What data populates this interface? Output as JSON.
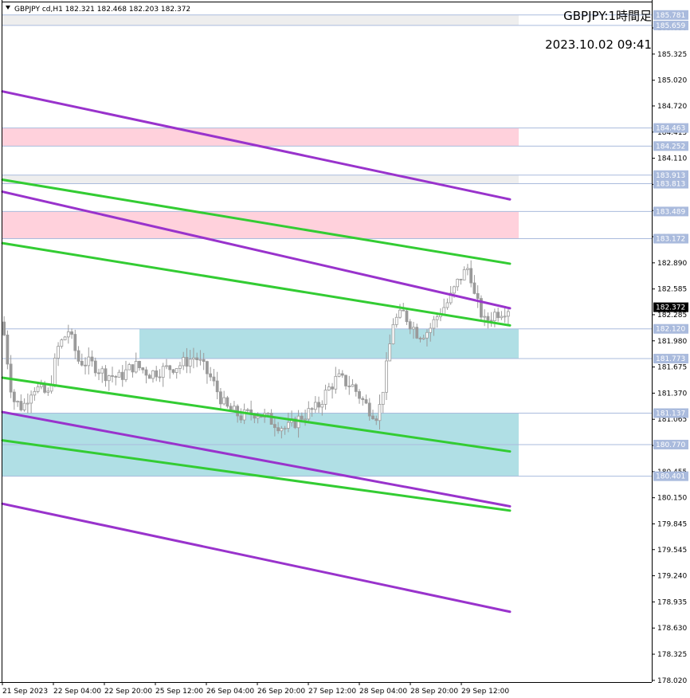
{
  "header": {
    "symbol_line": "GBPJPY cd,H1  182.321 182.468 182.203 182.372",
    "title": "GBPJPY:1時間足",
    "datetime": "2023.10.02 09:41"
  },
  "chart_data": {
    "type": "candlestick",
    "ylim": [
      178.0,
      185.9
    ],
    "price_ticks": [
      "185.630",
      "185.325",
      "185.020",
      "184.720",
      "184.415",
      "184.110",
      "183.805",
      "183.500",
      "183.195",
      "182.890",
      "182.585",
      "182.285",
      "181.980",
      "181.675",
      "181.370",
      "181.065",
      "180.760",
      "180.455",
      "180.150",
      "179.845",
      "179.545",
      "179.240",
      "178.935",
      "178.630",
      "178.325",
      "178.020"
    ],
    "time_labels": [
      "21 Sep 2023",
      "22 Sep 04:00",
      "22 Sep 20:00",
      "25 Sep 12:00",
      "26 Sep 04:00",
      "26 Sep 20:00",
      "27 Sep 12:00",
      "28 Sep 04:00",
      "28 Sep 20:00",
      "29 Sep 12:00"
    ],
    "current_price": "182.372",
    "levels": [
      {
        "label": "185.781",
        "price": 185.781,
        "color": "#aabbdd"
      },
      {
        "label": "185.659",
        "price": 185.659,
        "color": "#aabbdd"
      },
      {
        "label": "184.463",
        "price": 184.463,
        "color": "#aabbdd"
      },
      {
        "label": "184.252",
        "price": 184.252,
        "color": "#aabbdd"
      },
      {
        "label": "183.913",
        "price": 183.913,
        "color": "#aabbdd"
      },
      {
        "label": "183.813",
        "price": 183.813,
        "color": "#aabbdd"
      },
      {
        "label": "183.489",
        "price": 183.489,
        "color": "#aabbdd"
      },
      {
        "label": "183.172",
        "price": 183.172,
        "color": "#aabbdd"
      },
      {
        "label": "182.120",
        "price": 182.12,
        "color": "#aabbdd"
      },
      {
        "label": "181.773",
        "price": 181.773,
        "color": "#aabbdd"
      },
      {
        "label": "181.137",
        "price": 181.137,
        "color": "#aabbdd"
      },
      {
        "label": "180.770",
        "price": 180.77,
        "color": "#aabbdd"
      },
      {
        "label": "180.401",
        "price": 180.401,
        "color": "#aabbdd"
      }
    ],
    "zones": [
      {
        "top": 185.781,
        "bottom": 185.659,
        "color": "#eeeeee"
      },
      {
        "top": 184.463,
        "bottom": 184.252,
        "color": "#ffd1dc"
      },
      {
        "top": 183.913,
        "bottom": 183.813,
        "color": "#eeeeee"
      },
      {
        "top": 183.489,
        "bottom": 183.172,
        "color": "#ffd1dc"
      },
      {
        "top": 182.12,
        "bottom": 181.773,
        "color": "#b0dfe5",
        "start": 0.27
      },
      {
        "top": 181.137,
        "bottom": 180.401,
        "color": "#b0dfe5"
      }
    ],
    "trendlines": [
      {
        "color": "#9933cc",
        "from": [
          0.0,
          184.89
        ],
        "to": [
          1.0,
          183.63
        ]
      },
      {
        "color": "#9933cc",
        "from": [
          0.0,
          183.72
        ],
        "to": [
          1.0,
          182.36
        ]
      },
      {
        "color": "#9933cc",
        "from": [
          0.0,
          181.15
        ],
        "to": [
          1.0,
          180.05
        ]
      },
      {
        "color": "#9933cc",
        "from": [
          0.0,
          180.08
        ],
        "to": [
          1.0,
          178.82
        ]
      },
      {
        "color": "#33cc33",
        "from": [
          0.0,
          183.86
        ],
        "to": [
          1.0,
          182.88
        ]
      },
      {
        "color": "#33cc33",
        "from": [
          0.0,
          183.12
        ],
        "to": [
          1.0,
          182.16
        ]
      },
      {
        "color": "#33cc33",
        "from": [
          0.0,
          181.55
        ],
        "to": [
          1.0,
          180.69
        ]
      },
      {
        "color": "#33cc33",
        "from": [
          0.0,
          180.82
        ],
        "to": [
          1.0,
          180.0
        ]
      }
    ],
    "close_path": [
      [
        0.0,
        182.2
      ],
      [
        0.02,
        181.3
      ],
      [
        0.04,
        181.2
      ],
      [
        0.06,
        181.45
      ],
      [
        0.09,
        181.35
      ],
      [
        0.11,
        181.9
      ],
      [
        0.13,
        182.1
      ],
      [
        0.15,
        181.75
      ],
      [
        0.18,
        181.7
      ],
      [
        0.2,
        181.6
      ],
      [
        0.23,
        181.55
      ],
      [
        0.26,
        181.7
      ],
      [
        0.29,
        181.6
      ],
      [
        0.32,
        181.65
      ],
      [
        0.35,
        181.7
      ],
      [
        0.38,
        181.8
      ],
      [
        0.41,
        181.55
      ],
      [
        0.44,
        181.2
      ],
      [
        0.47,
        181.1
      ],
      [
        0.5,
        181.15
      ],
      [
        0.53,
        181.05
      ],
      [
        0.56,
        180.95
      ],
      [
        0.59,
        181.1
      ],
      [
        0.62,
        181.2
      ],
      [
        0.64,
        181.4
      ],
      [
        0.66,
        181.55
      ],
      [
        0.69,
        181.45
      ],
      [
        0.72,
        181.2
      ],
      [
        0.74,
        181.1
      ],
      [
        0.755,
        181.6
      ],
      [
        0.77,
        182.2
      ],
      [
        0.79,
        182.3
      ],
      [
        0.82,
        182.05
      ],
      [
        0.84,
        182.1
      ],
      [
        0.86,
        182.3
      ],
      [
        0.88,
        182.45
      ],
      [
        0.9,
        182.7
      ],
      [
        0.92,
        182.85
      ],
      [
        0.93,
        182.5
      ],
      [
        0.95,
        182.2
      ],
      [
        0.97,
        182.3
      ],
      [
        1.0,
        182.37
      ]
    ]
  }
}
